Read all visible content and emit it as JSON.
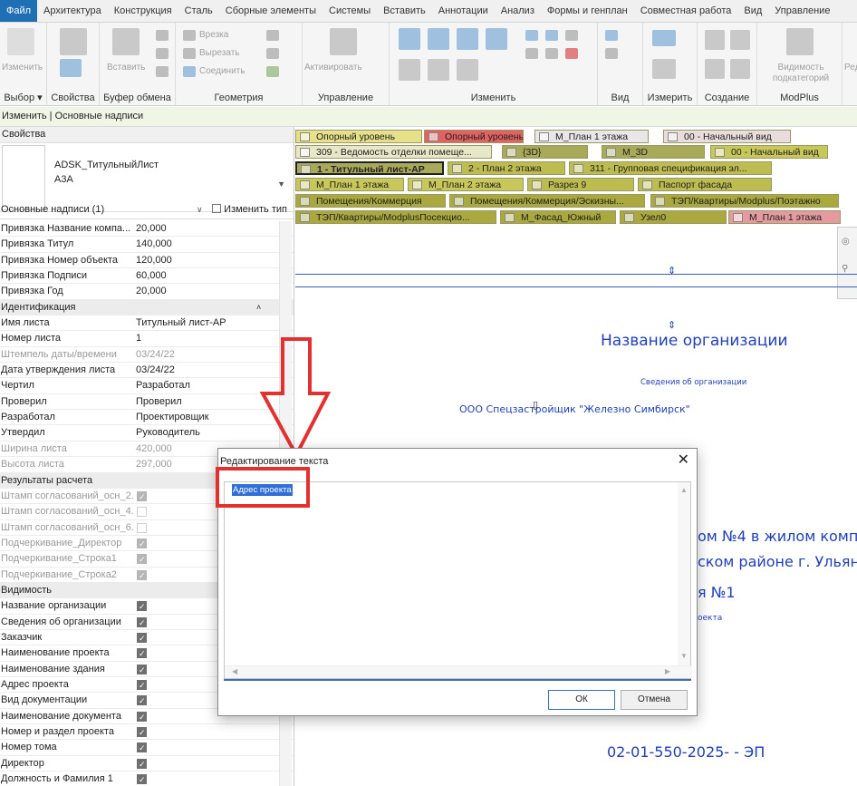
{
  "ribbon": {
    "tabs": [
      "Файл",
      "Архитектура",
      "Конструкция",
      "Сталь",
      "Сборные элементы",
      "Системы",
      "Вставить",
      "Аннотации",
      "Анализ",
      "Формы и генплан",
      "Совместная работа",
      "Вид",
      "Управление"
    ],
    "active_tab": "Файл",
    "groups": {
      "select_label": "Выбор ▾",
      "properties_label": "Свойства",
      "clipboard_label": "Буфер обмена",
      "geometry_label": "Геометрия",
      "control_label": "Управление",
      "modify_label": "Изменить",
      "view_label": "Вид",
      "measure_label": "Измерить",
      "create_label": "Создание",
      "modplus_label": "ModPlus"
    },
    "buttons": {
      "modify": "Изменить",
      "paste": "Вставить",
      "cut_notch": "Врезка",
      "cut": "Вырезать",
      "join": "Соединить",
      "activate": "Активировать",
      "visibility": "Видимость подкатегорий",
      "extra": "Ред"
    }
  },
  "context_bar": "Изменить | Основные надписи",
  "properties": {
    "header": "Свойства",
    "type_name_line1": "ADSK_ТитульныйЛист",
    "type_name_line2": "А3А",
    "filter": "Основные надписи (1)",
    "edit_type": "Изменить тип",
    "rows": [
      {
        "k": "Привязка Название компа...",
        "v": "20,000",
        "kind": "val"
      },
      {
        "k": "Привязка Титул",
        "v": "140,000",
        "kind": "val"
      },
      {
        "k": "Привязка Номер объекта",
        "v": "120,000",
        "kind": "val"
      },
      {
        "k": "Привязка Подписи",
        "v": "60,000",
        "kind": "val"
      },
      {
        "k": "Привязка Год",
        "v": "20,000",
        "kind": "val"
      },
      {
        "k": "Идентификация",
        "v": "",
        "kind": "grp"
      },
      {
        "k": "Имя листа",
        "v": "Титульный лист-АР",
        "kind": "val"
      },
      {
        "k": "Номер листа",
        "v": "1",
        "kind": "val"
      },
      {
        "k": "Штемпель даты/времени",
        "v": "03/24/22",
        "kind": "dis"
      },
      {
        "k": "Дата утверждения листа",
        "v": "03/24/22",
        "kind": "val"
      },
      {
        "k": "Чертил",
        "v": "Разработал",
        "kind": "val"
      },
      {
        "k": "Проверил",
        "v": "Проверил",
        "kind": "val"
      },
      {
        "k": "Разработал",
        "v": "Проектировщик",
        "kind": "val"
      },
      {
        "k": "Утвердил",
        "v": "Руководитель",
        "kind": "val"
      },
      {
        "k": "Ширина листа",
        "v": "420,000",
        "kind": "dis"
      },
      {
        "k": "Высота листа",
        "v": "297,000",
        "kind": "dis"
      },
      {
        "k": "Результаты расчета",
        "v": "",
        "kind": "grp"
      },
      {
        "k": "Штамп согласований_осн_2...",
        "v": "",
        "kind": "cbdis",
        "checked": true
      },
      {
        "k": "Штамп согласований_осн_4...",
        "v": "",
        "kind": "cbdis",
        "checked": false
      },
      {
        "k": "Штамп согласований_осн_6...",
        "v": "",
        "kind": "cbdis",
        "checked": false
      },
      {
        "k": "Подчеркивание_Директор",
        "v": "",
        "kind": "cbdis",
        "checked": true
      },
      {
        "k": "Подчеркивание_Строка1",
        "v": "",
        "kind": "cbdis",
        "checked": true
      },
      {
        "k": "Подчеркивание_Строка2",
        "v": "",
        "kind": "cbdis",
        "checked": true
      },
      {
        "k": "Видимость",
        "v": "",
        "kind": "grp"
      },
      {
        "k": "Название организации",
        "v": "",
        "kind": "cb",
        "checked": true
      },
      {
        "k": "Сведения об организации",
        "v": "",
        "kind": "cb",
        "checked": true
      },
      {
        "k": "Заказчик",
        "v": "",
        "kind": "cb",
        "checked": true
      },
      {
        "k": "Наименование проекта",
        "v": "",
        "kind": "cb",
        "checked": true
      },
      {
        "k": "Наименование здания",
        "v": "",
        "kind": "cb",
        "checked": true
      },
      {
        "k": "Адрес проекта",
        "v": "",
        "kind": "cb",
        "checked": true
      },
      {
        "k": "Вид документации",
        "v": "",
        "kind": "cb",
        "checked": true
      },
      {
        "k": "Наименование документа",
        "v": "",
        "kind": "cb",
        "checked": true
      },
      {
        "k": "Номер и раздел проекта",
        "v": "",
        "kind": "cb",
        "checked": true
      },
      {
        "k": "Номер тома",
        "v": "",
        "kind": "cb",
        "checked": true
      },
      {
        "k": "Директор",
        "v": "",
        "kind": "cb",
        "checked": true
      },
      {
        "k": "Должность и Фамилия 1",
        "v": "",
        "kind": "cb",
        "checked": true
      }
    ]
  },
  "view_tabs": [
    {
      "label": "Опорный уровень",
      "color": "#e6e08a",
      "sel": false
    },
    {
      "label": "Опорный уровень",
      "color": "#e06262",
      "sel": false
    },
    {
      "label": "М_План 1 этажа",
      "color": "#e7e7e7",
      "sel": false
    },
    {
      "label": "00 - Начальный вид",
      "color": "#e8dcdc",
      "sel": false
    },
    {
      "label": "309 - Ведомость отделки помеще...",
      "color": "#e8e8c8",
      "sel": false
    },
    {
      "label": "{3D}",
      "color": "#a9a95a",
      "sel": false
    },
    {
      "label": "M_3D",
      "color": "#a9a95a",
      "sel": false
    },
    {
      "label": "00 - Начальный вид",
      "color": "#c8c85a",
      "sel": false
    },
    {
      "label": "1 - Титульный лист-АР",
      "color": "#a9a95a",
      "sel": true
    },
    {
      "label": "2 - План 2 этажа",
      "color": "#bcbc50",
      "sel": false
    },
    {
      "label": "311 - Групповая спецификация эл...",
      "color": "#bcbc50",
      "sel": false
    },
    {
      "label": "М_План 1 этажа",
      "color": "#c8c85a",
      "sel": false
    },
    {
      "label": "М_План 2 этажа",
      "color": "#c8c85a",
      "sel": false
    },
    {
      "label": "Разрез 9",
      "color": "#bcbc50",
      "sel": false
    },
    {
      "label": "Паспорт фасада",
      "color": "#bcbc50",
      "sel": false
    },
    {
      "label": "Помещения/Коммерция",
      "color": "#a9a940",
      "sel": false
    },
    {
      "label": "Помещения/Коммерция/Эскизны...",
      "color": "#a9a940",
      "sel": false
    },
    {
      "label": "ТЭП/Квартиры/Modplus/Поэтажно",
      "color": "#a9a940",
      "sel": false
    },
    {
      "label": "ТЭП/Квартиры/ModplusПосекцио...",
      "color": "#a9a940",
      "sel": false
    },
    {
      "label": "М_Фасад_Южный",
      "color": "#a9a940",
      "sel": false
    },
    {
      "label": "Узел0",
      "color": "#a9a940",
      "sel": false
    },
    {
      "label": "М_План 1 этажа",
      "color": "#e59aa0",
      "sel": false
    }
  ],
  "sheet": {
    "org_name": "Название организации",
    "org_info": "Сведения об организации",
    "customer": "ООО Спецзастройщик \"Железно Симбирск\"",
    "project_line1": "ом №4 в жилом комп",
    "project_line2": "ском районе г. Ульян",
    "project_line3": "я №1",
    "project_line4": "оекта",
    "doc_number": "02-01-550-2025- - ЭП"
  },
  "dialog": {
    "title": "Редактирование текста",
    "selected_text": "Адрес проекта",
    "ok": "ОК",
    "cancel": "Отмена"
  },
  "colors": {
    "accent": "#1f6fb5",
    "highlight": "#e53030",
    "sheet_text": "#1f3fbf"
  }
}
